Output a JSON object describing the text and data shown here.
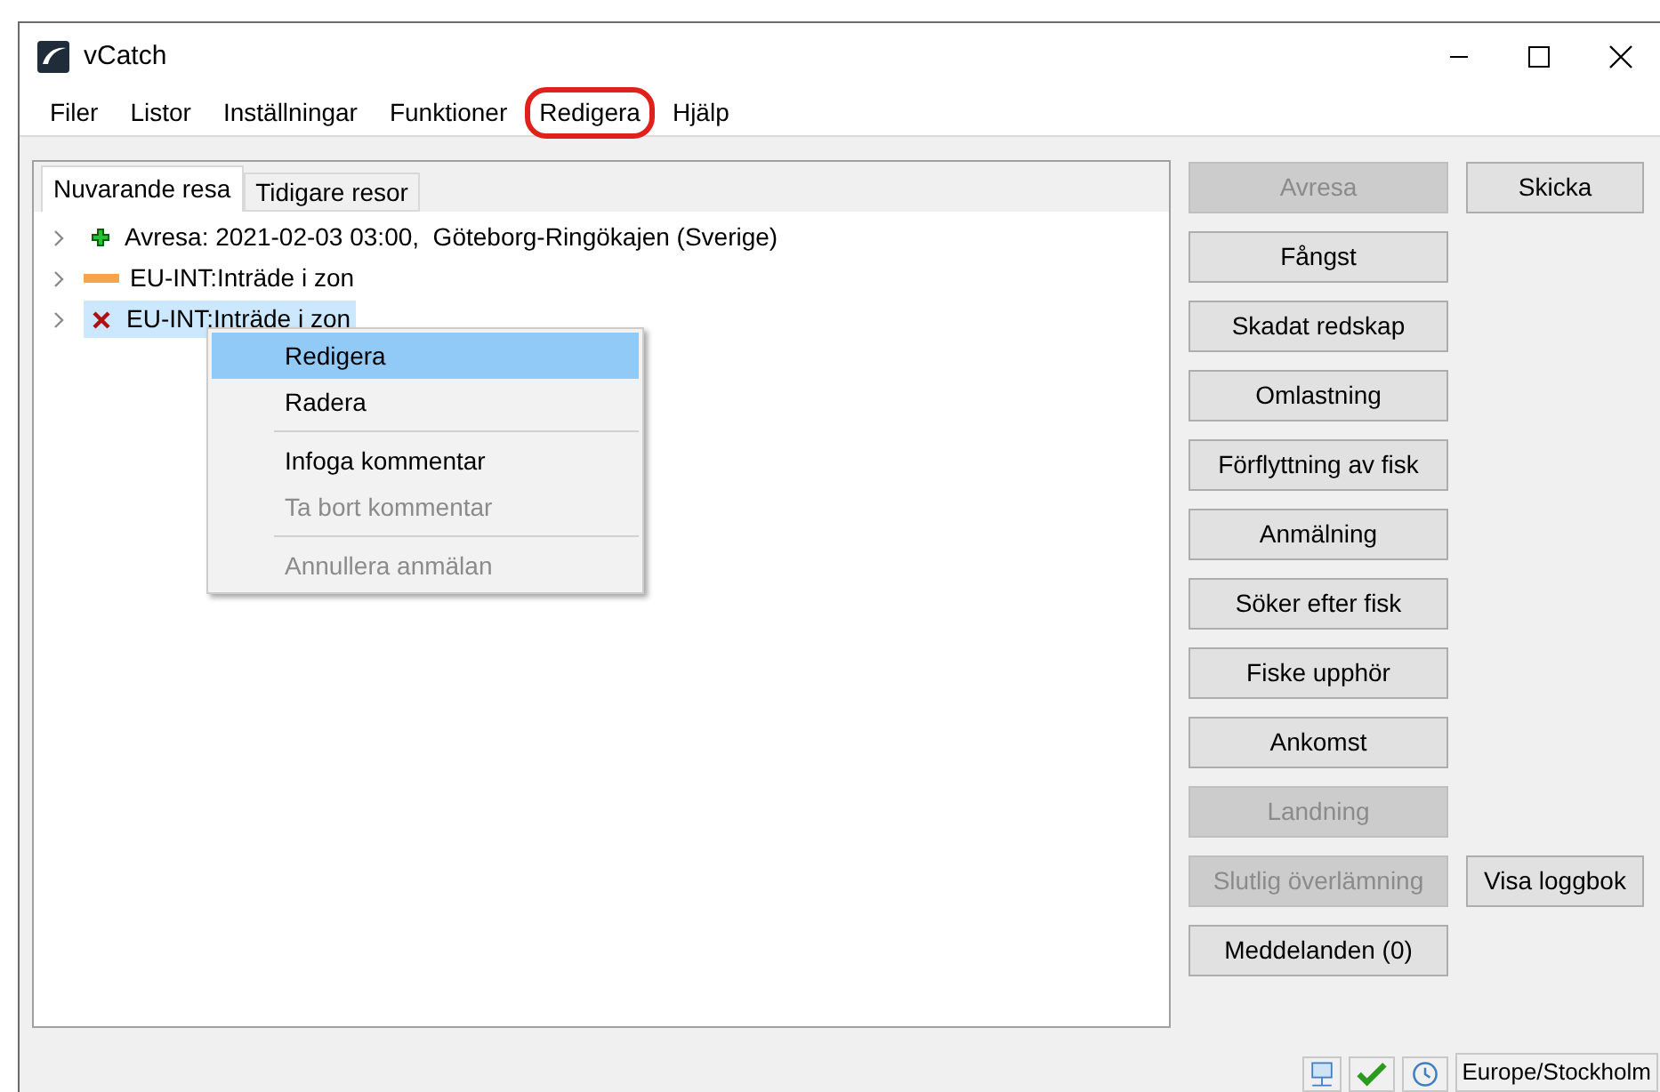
{
  "window": {
    "title": "vCatch"
  },
  "menu": [
    {
      "label": "Filer",
      "annotated": false
    },
    {
      "label": "Listor",
      "annotated": false
    },
    {
      "label": "Inställningar",
      "annotated": false
    },
    {
      "label": "Funktioner",
      "annotated": false
    },
    {
      "label": "Redigera",
      "annotated": true
    },
    {
      "label": "Hjälp",
      "annotated": false
    }
  ],
  "tabs": [
    {
      "label": "Nuvarande resa",
      "selected": true
    },
    {
      "label": "Tidigare resor",
      "selected": false
    }
  ],
  "tree": [
    {
      "kind": "plus",
      "label": "Avresa: 2021-02-03 03:00,  Göteborg-Ringökajen (Sverige)",
      "selected": false
    },
    {
      "kind": "bar",
      "label": "EU-INT:Inträde i zon",
      "selected": false
    },
    {
      "kind": "cross",
      "label": "EU-INT:Inträde i zon",
      "selected": true
    }
  ],
  "context_menu": [
    {
      "kind": "item",
      "label": "Redigera",
      "selected": true,
      "disabled": false
    },
    {
      "kind": "item",
      "label": "Radera",
      "selected": false,
      "disabled": false
    },
    {
      "kind": "separator"
    },
    {
      "kind": "item",
      "label": "Infoga kommentar",
      "selected": false,
      "disabled": false
    },
    {
      "kind": "item",
      "label": "Ta bort kommentar",
      "selected": false,
      "disabled": true
    },
    {
      "kind": "separator"
    },
    {
      "kind": "item",
      "label": "Annullera anmälan",
      "selected": false,
      "disabled": true
    }
  ],
  "button_rows": [
    [
      {
        "label": "Avresa",
        "disabled": true
      },
      {
        "label": "Skicka",
        "disabled": false
      }
    ],
    [
      {
        "label": "Fångst",
        "disabled": false
      }
    ],
    [
      {
        "label": "Skadat redskap",
        "disabled": false
      }
    ],
    [
      {
        "label": "Omlastning",
        "disabled": false
      }
    ],
    [
      {
        "label": "Förflyttning av fisk",
        "disabled": false
      }
    ],
    [
      {
        "label": "Anmälning",
        "disabled": false
      }
    ],
    [
      {
        "label": "Söker efter fisk",
        "disabled": false
      }
    ],
    [
      {
        "label": "Fiske upphör",
        "disabled": false
      }
    ],
    [
      {
        "label": "Ankomst",
        "disabled": false
      }
    ],
    [
      {
        "label": "Landning",
        "disabled": true
      }
    ],
    [
      {
        "label": "Slutlig överlämning",
        "disabled": true
      },
      {
        "label": "Visa loggbok",
        "disabled": false
      }
    ],
    [
      {
        "label": "Meddelanden (0)",
        "disabled": false
      }
    ]
  ],
  "status_bar": {
    "timezone": "Europe/Stockholm"
  }
}
